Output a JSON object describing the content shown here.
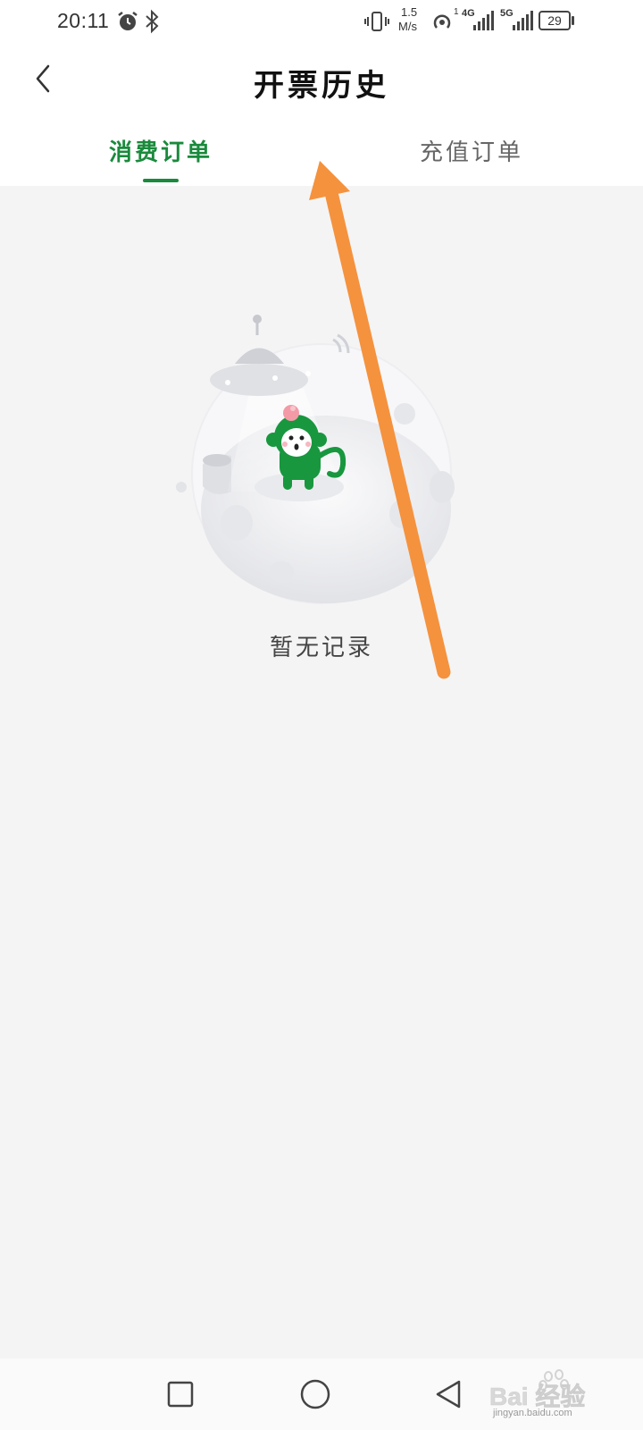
{
  "status_bar": {
    "time": "20:11",
    "net_speed_value": "1.5",
    "net_speed_unit": "M/s",
    "net_4g": "4G",
    "net_5g": "5G",
    "hotspot_count": "1",
    "battery": "29"
  },
  "header": {
    "title": "开票历史",
    "back_icon": "chevron-left-icon"
  },
  "tabs": [
    {
      "label": "消费订单",
      "active": true
    },
    {
      "label": "充值订单",
      "active": false
    }
  ],
  "empty_state": {
    "message": "暂无记录",
    "illustration": "ufo-monkey-moon"
  },
  "colors": {
    "accent": "#1a8a3c",
    "background": "#f4f4f5",
    "annotation": "#f5923e"
  },
  "nav_bar": {
    "recent_icon": "square-icon",
    "home_icon": "circle-icon",
    "back_icon": "triangle-back-icon"
  },
  "watermark": {
    "brand": "Bai 经验",
    "url": "jingyan.baidu.com"
  }
}
